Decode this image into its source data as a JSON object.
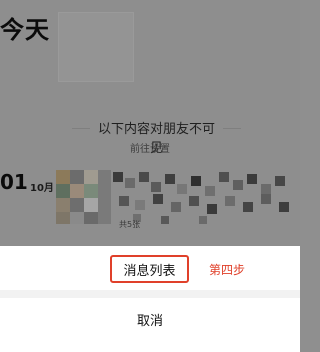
{
  "header": {
    "title": "今天"
  },
  "notice": {
    "text": "以下内容对朋友不可见",
    "link": "前往设置"
  },
  "post": {
    "day": "01",
    "month": "10月",
    "meta": "共5张"
  },
  "action_sheet": {
    "option_label": "消息列表",
    "annotation": "第四步",
    "cancel_label": "取消"
  },
  "colors": {
    "accent": "#e0402a",
    "overlay": "#8e8e8e",
    "sheet_bg": "#ffffff"
  }
}
